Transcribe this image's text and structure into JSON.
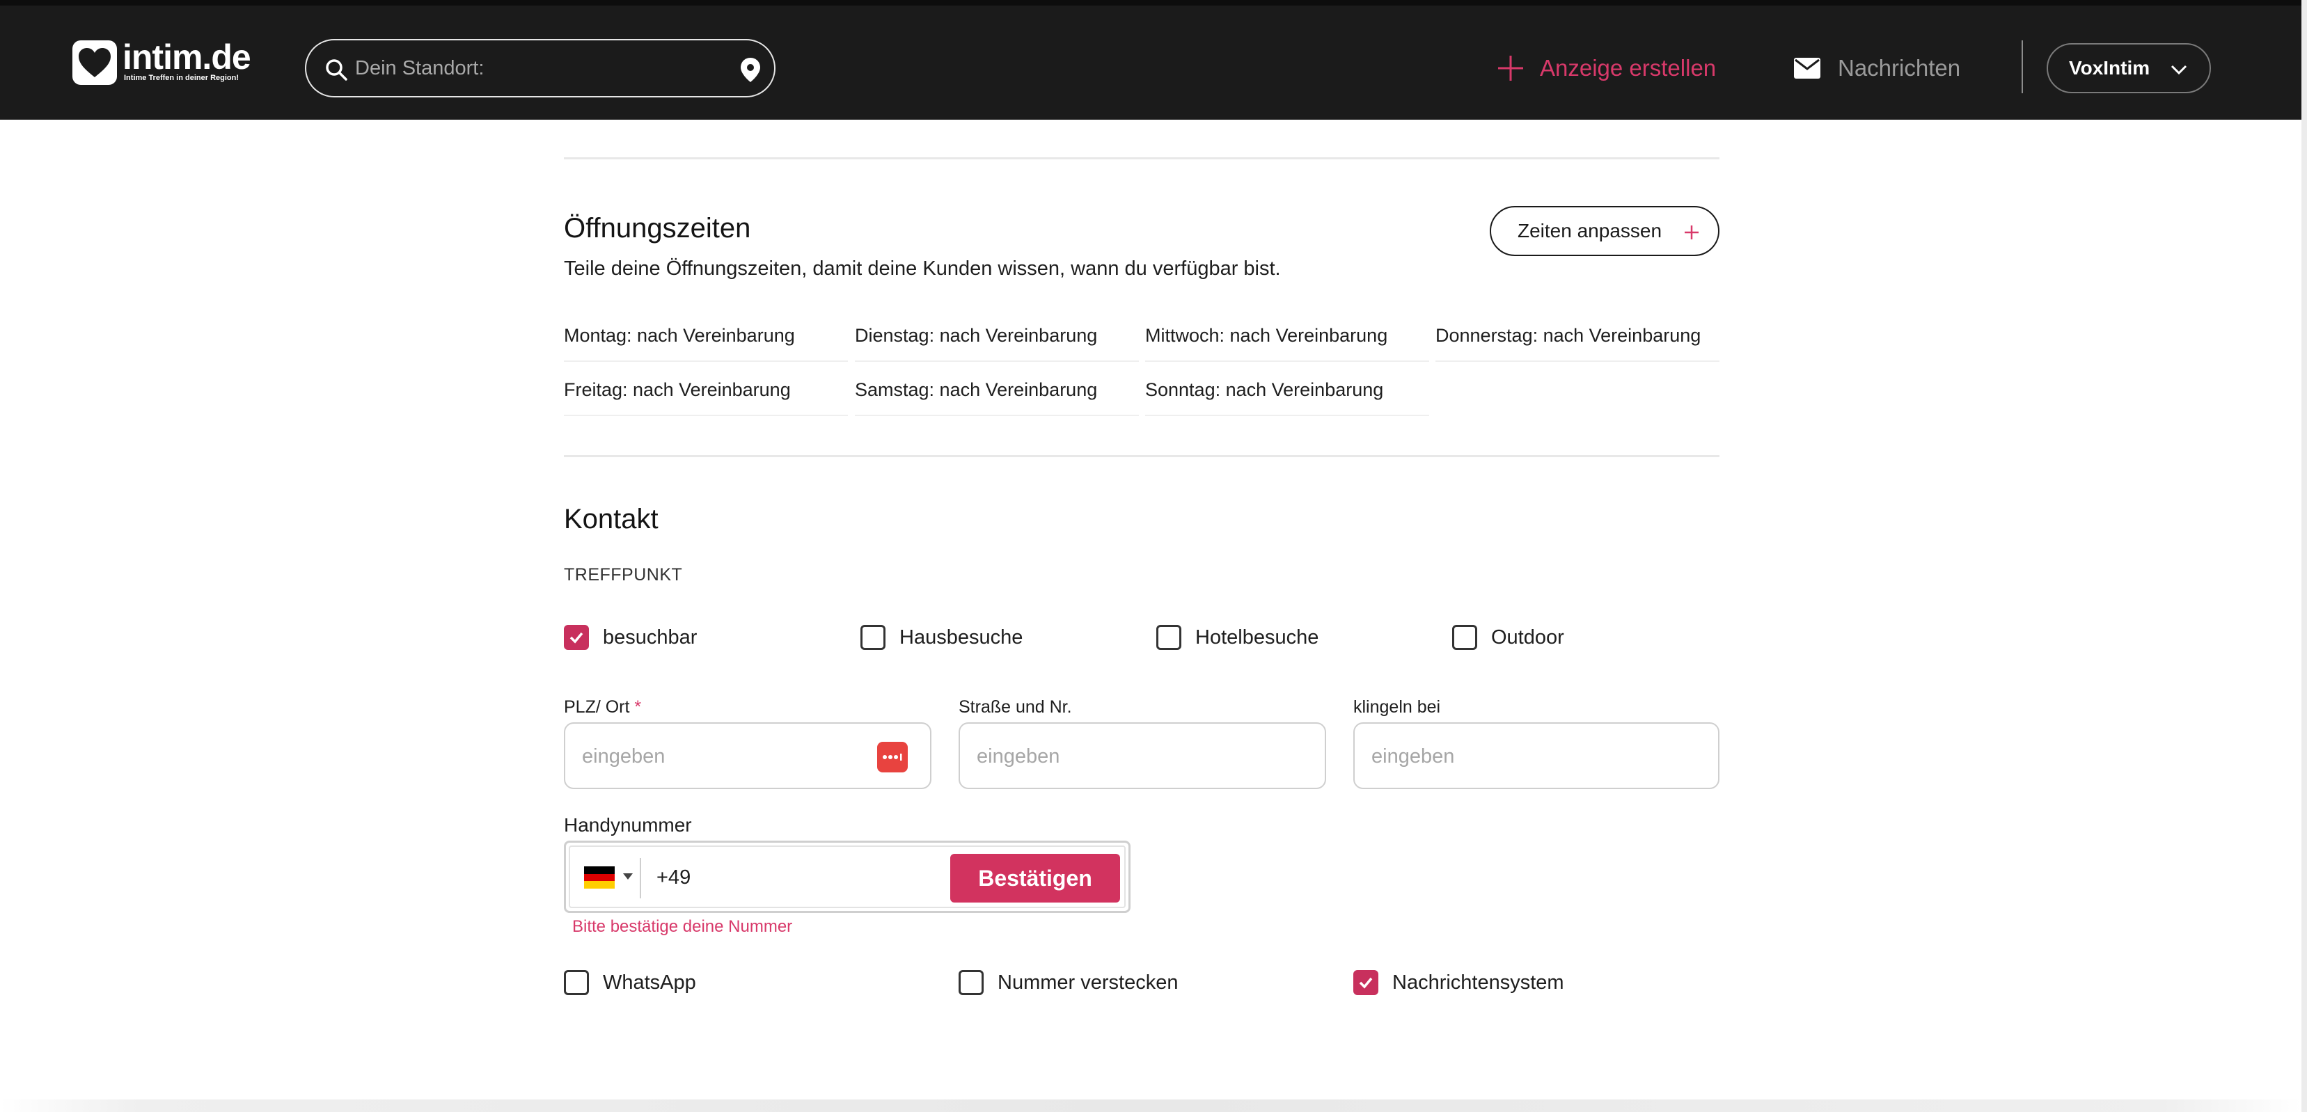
{
  "header": {
    "logo_text": "intim.de",
    "logo_subtitle": "Intime Treffen in deiner Region!",
    "search_placeholder": "Dein Standort:",
    "create_ad_label": "Anzeige erstellen",
    "messages_label": "Nachrichten",
    "user_name": "VoxIntim",
    "accent_color": "#d8396a"
  },
  "opening_hours": {
    "title": "Öffnungszeiten",
    "description": "Teile deine Öffnungszeiten, damit deine Kunden wissen, wann du verfügbar bist.",
    "adjust_button": "Zeiten anpassen",
    "days": [
      "Montag: nach Vereinbarung",
      "Dienstag: nach Vereinbarung",
      "Mittwoch: nach Vereinbarung",
      "Donnerstag: nach Vereinbarung",
      "Freitag: nach Vereinbarung",
      "Samstag: nach Vereinbarung",
      "Sonntag: nach Vereinbarung"
    ]
  },
  "contact": {
    "title": "Kontakt",
    "meeting_point_label": "TREFFPUNKT",
    "meeting_options": [
      {
        "label": "besuchbar",
        "checked": true
      },
      {
        "label": "Hausbesuche",
        "checked": false
      },
      {
        "label": "Hotelbesuche",
        "checked": false
      },
      {
        "label": "Outdoor",
        "checked": false
      }
    ],
    "zip_label": "PLZ/ Ort",
    "zip_required_mark": "*",
    "zip_placeholder": "eingeben",
    "street_label": "Straße und Nr.",
    "street_placeholder": "eingeben",
    "bell_label": "klingeln bei",
    "bell_placeholder": "eingeben",
    "phone_label": "Handynummer",
    "phone_prefix": "+49",
    "confirm_button": "Bestätigen",
    "phone_error": "Bitte bestätige deine Nummer",
    "phone_options": [
      {
        "label": "WhatsApp",
        "checked": false
      },
      {
        "label": "Nummer verstecken",
        "checked": false
      },
      {
        "label": "Nachrichtensystem",
        "checked": true
      }
    ]
  }
}
